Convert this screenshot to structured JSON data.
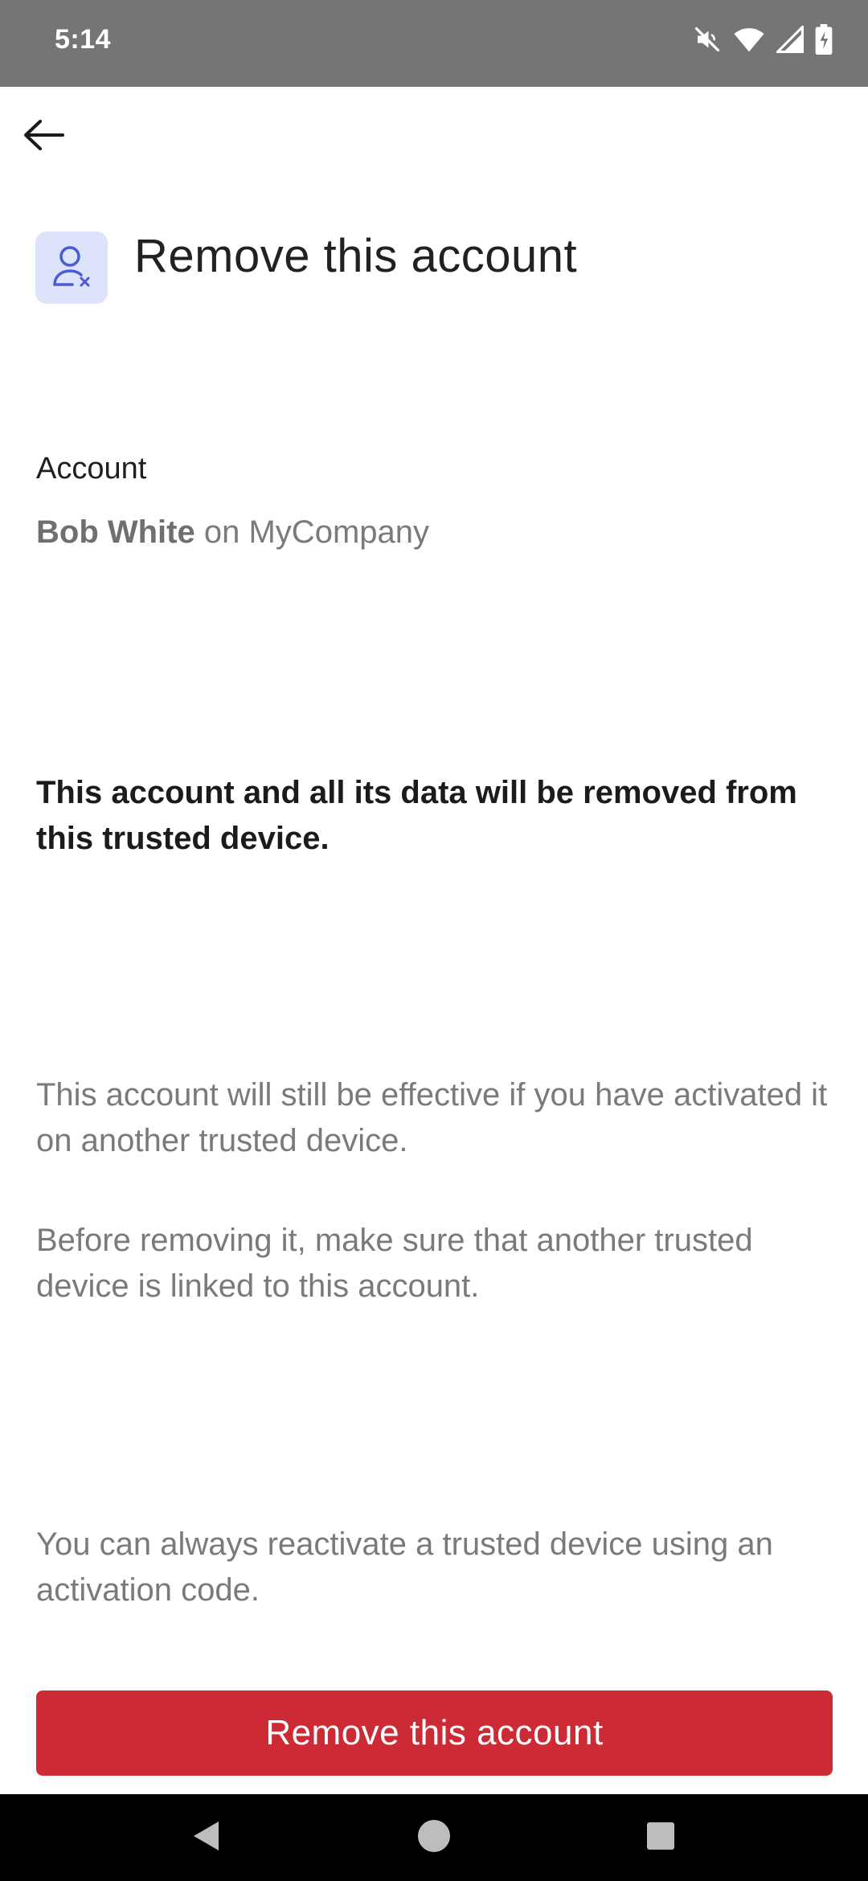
{
  "status_bar": {
    "time": "5:14",
    "icons": [
      "mute-icon",
      "wifi-icon",
      "signal-icon",
      "battery-charging-icon"
    ]
  },
  "nav": {
    "back_icon": "arrow-left-icon"
  },
  "header": {
    "icon": "user-remove-icon",
    "title": "Remove this account"
  },
  "account": {
    "label": "Account",
    "name": "Bob White",
    "connector": "on",
    "company": "MyCompany"
  },
  "warning": "This account and all its data will be removed from this trusted device.",
  "info": [
    "This account will still be effective if you have activated it on another trusted device.",
    "Before removing it, make sure that another trusted device is linked to this account.",
    "You can always reactivate a trusted device using an activation code."
  ],
  "actions": {
    "remove_label": "Remove this account"
  },
  "system_nav": {
    "buttons": [
      "back-triangle-icon",
      "home-circle-icon",
      "recents-square-icon"
    ]
  },
  "colors": {
    "status_bar": "#757575",
    "accent_tile": "#dde3fb",
    "accent_icon": "#4b5bd6",
    "danger": "#cc2a35"
  }
}
